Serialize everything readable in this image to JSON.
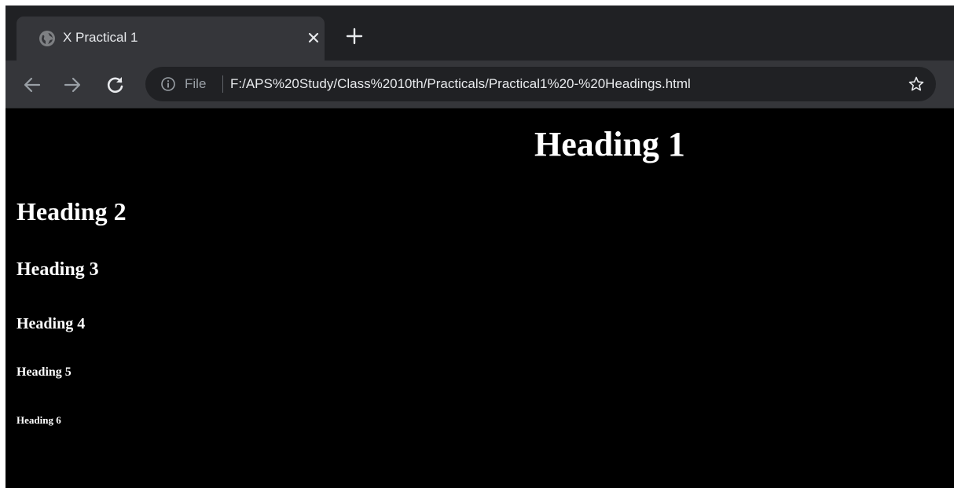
{
  "browser": {
    "tab": {
      "title": "X Practical 1",
      "favicon": "globe-icon"
    },
    "new_tab_icon": "plus-icon",
    "close_icon": "close-icon",
    "toolbar": {
      "back_icon": "arrow-left-icon",
      "forward_icon": "arrow-right-icon",
      "reload_icon": "reload-icon",
      "info_icon": "info-icon",
      "scheme_label": "File",
      "url": "F:/APS%20Study/Class%2010th/Practicals/Practical1%20-%20Headings.html",
      "bookmark_icon": "star-icon"
    },
    "colors": {
      "tabstrip": "#202124",
      "active_tab": "#35363a",
      "omnibox": "#202124",
      "text": "#e8eaed",
      "muted": "#9aa0a6"
    }
  },
  "page": {
    "background": "#000000",
    "text_color": "#ffffff",
    "headings": {
      "h1": "Heading 1",
      "h2": "Heading 2",
      "h3": "Heading 3",
      "h4": "Heading 4",
      "h5": "Heading 5",
      "h6": "Heading 6"
    }
  }
}
